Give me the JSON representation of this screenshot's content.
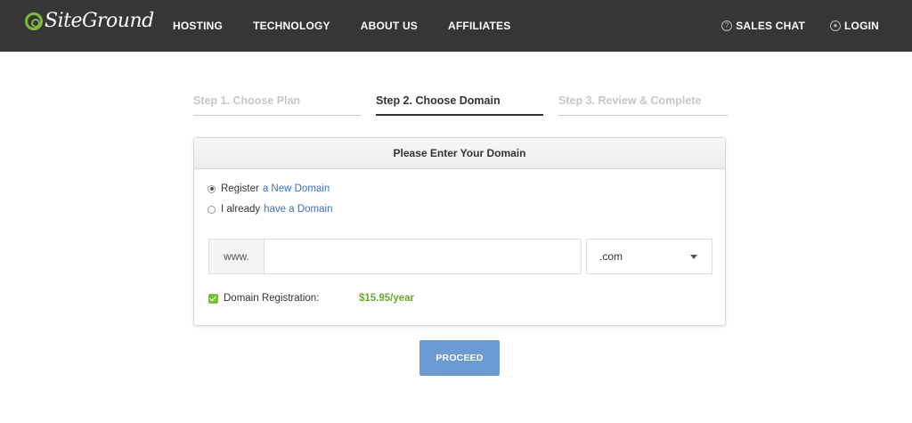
{
  "brand": {
    "logo_text": "SiteGround",
    "accent_color": "#7dbb3e"
  },
  "nav": {
    "items": [
      {
        "label": "HOSTING"
      },
      {
        "label": "TECHNOLOGY"
      },
      {
        "label": "ABOUT US"
      },
      {
        "label": "AFFILIATES"
      }
    ],
    "sales_chat": {
      "label": "SALES CHAT",
      "icon": "question-circle-icon"
    },
    "login": {
      "label": "LOGIN",
      "icon": "user-circle-icon"
    }
  },
  "steps": [
    {
      "label": "Step 1. Choose Plan",
      "state": "inactive"
    },
    {
      "label": "Step 2. Choose Domain",
      "state": "active"
    },
    {
      "label": "Step 3. Review & Complete",
      "state": "inactive"
    }
  ],
  "form": {
    "title": "Please Enter Your Domain",
    "options": [
      {
        "prefix": "Register",
        "link": "a New Domain",
        "checked": true
      },
      {
        "prefix": "I already",
        "link": "have a Domain",
        "checked": false
      }
    ],
    "domain_prefix": "www.",
    "domain_value": "",
    "domain_placeholder": "",
    "tld_selected": ".com",
    "registration": {
      "label": "Domain Registration:",
      "price": "$15.95/year",
      "checked": true,
      "price_color": "#6aa62e"
    }
  },
  "proceed_label": "PROCEED",
  "colors": {
    "topbar": "#373634",
    "button": "#6b9bd2",
    "link": "#3a6fc4"
  }
}
